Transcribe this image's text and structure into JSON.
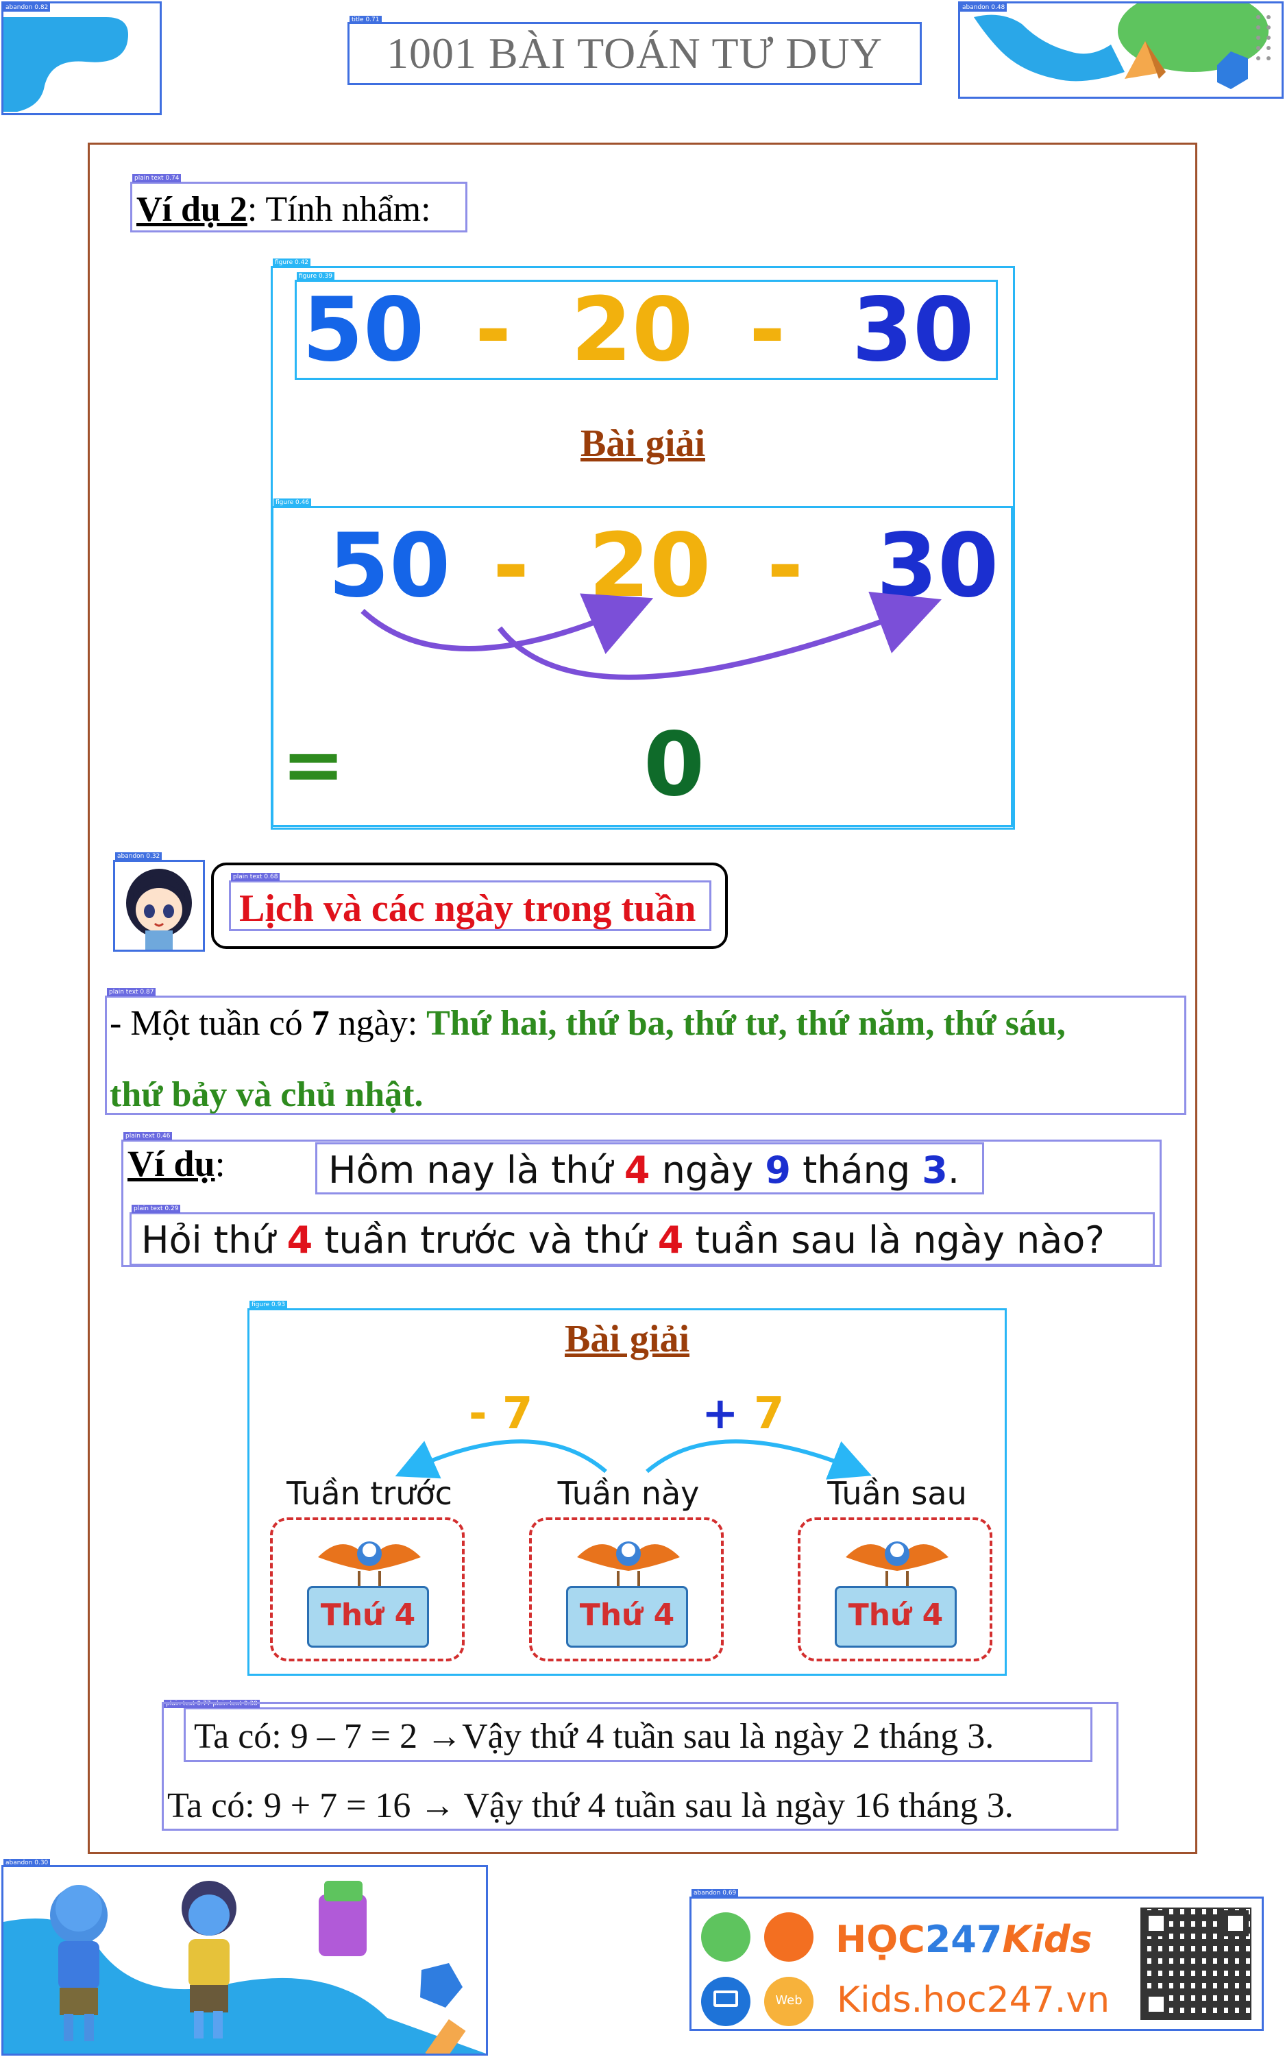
{
  "header": {
    "title": "1001 BÀI TOÁN TƯ DUY"
  },
  "example2": {
    "label": "Ví dụ 2",
    "text": ": Tính nhẩm:",
    "expr": [
      "50",
      "-",
      "20",
      "-",
      "30"
    ],
    "solution_title": "Bài giải",
    "equals": "=",
    "result": "0"
  },
  "section": {
    "title": "Lịch và các ngày trong tuần"
  },
  "week": {
    "intro": "- Một tuần có ",
    "num": "7",
    "mid": " ngày: ",
    "days1": "Thứ hai, thứ ba, thứ tư, thứ năm, thứ sáu,",
    "days2": "thứ bảy và chủ nhật."
  },
  "example": {
    "label": "Ví dụ",
    "colon": ":",
    "line1": {
      "a": "Hôm nay là thứ ",
      "b": "4",
      "c": " ngày ",
      "d": "9",
      "e": " tháng ",
      "f": "3",
      "g": "."
    },
    "line2": {
      "a": "Hỏi thứ ",
      "b": "4",
      "c": " tuần trước và thứ ",
      "d": "4",
      "e": " tuần sau là ngày nào?"
    }
  },
  "solution": {
    "title": "Bài giải",
    "minus_label": "- 7",
    "plus_sign": "+",
    "plus_num": "7",
    "weeks": [
      {
        "name": "Tuần trước",
        "sign": "Thứ 4"
      },
      {
        "name": "Tuần này",
        "sign": "Thứ 4"
      },
      {
        "name": "Tuần sau",
        "sign": "Thứ 4"
      }
    ],
    "line1": "Ta có: 9 – 7 = 2 →Vậy thứ 4 tuần sau là ngày 2 tháng 3.",
    "line2": "Ta có: 9 + 7 = 16 → Vậy thứ 4 tuần sau là ngày 16 tháng 3."
  },
  "footer": {
    "brand_hoc": "HỌC",
    "brand_num": "247",
    "brand_kids": "Kids",
    "web_label": "Web",
    "url": "Kids.hoc247.vn"
  },
  "detector_tags": {
    "abandon_tl": "abandon 0.82",
    "title_tag": "title 0.71",
    "abandon_tr": "abandon 0.48",
    "text_ex2": "plain text 0.74",
    "fig_outer": "figure 0.42",
    "fig_inner": "figure 0.39",
    "fig_solution": "figure 0.46",
    "abandon_avatar": "abandon 0.32",
    "text_section": "plain text 0.68",
    "text_week": "plain text 0.87",
    "text_example": "plain text 0.46",
    "text_q": "plain text 0.29",
    "fig_weeks": "figure 0.93",
    "text_ans": "plain text 0.77 plain text 0.38",
    "abandon_bl": "abandon 0.30",
    "abandon_br": "abandon 0.69"
  },
  "colors": {
    "num_blue": "#1565e8",
    "num_green": "#0f6b2a",
    "num_gold": "#f2b10d",
    "red": "#e0121b",
    "green": "#2e8b1e",
    "brown": "#9a3d0a",
    "orange": "#f36f21"
  }
}
